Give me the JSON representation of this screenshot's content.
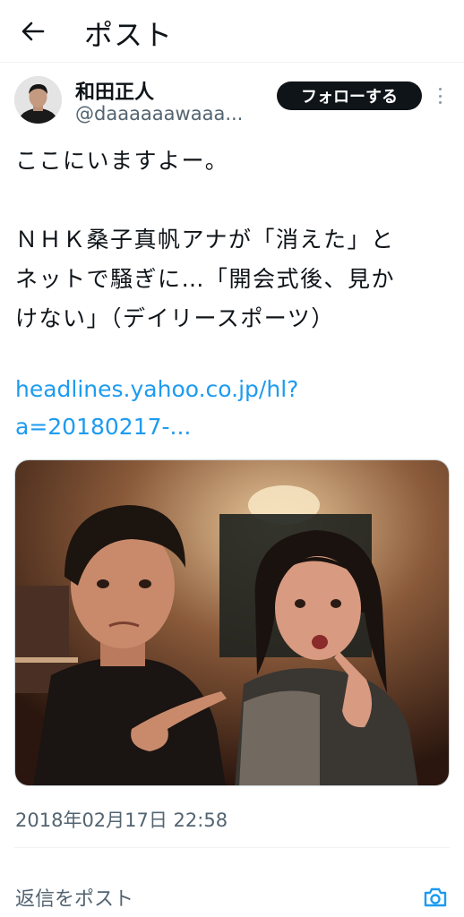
{
  "header": {
    "title": "ポスト",
    "back_icon": "arrow-left-icon"
  },
  "author": {
    "display_name": "和田正人",
    "handle": "@daaaaaawaaa..."
  },
  "follow_label": "フォローする",
  "more_icon": "more-vertical-icon",
  "tweet": {
    "line1": "ここにいますよー。",
    "line2": "ＮＨＫ桑子真帆アナが「消えた」と",
    "line3": "ネットで騒ぎに…「開会式後、見か",
    "line4": "けない」（デイリースポーツ）",
    "link_line1": "headlines.yahoo.co.jp/hl?",
    "link_line2": "a=20180217-..."
  },
  "timestamp": "2018年02月17日 22:58",
  "reply": {
    "placeholder": "返信をポスト",
    "camera_icon": "camera-icon"
  },
  "colors": {
    "link": "#1d9bf0",
    "muted": "#536471",
    "button_bg": "#0f1419"
  }
}
